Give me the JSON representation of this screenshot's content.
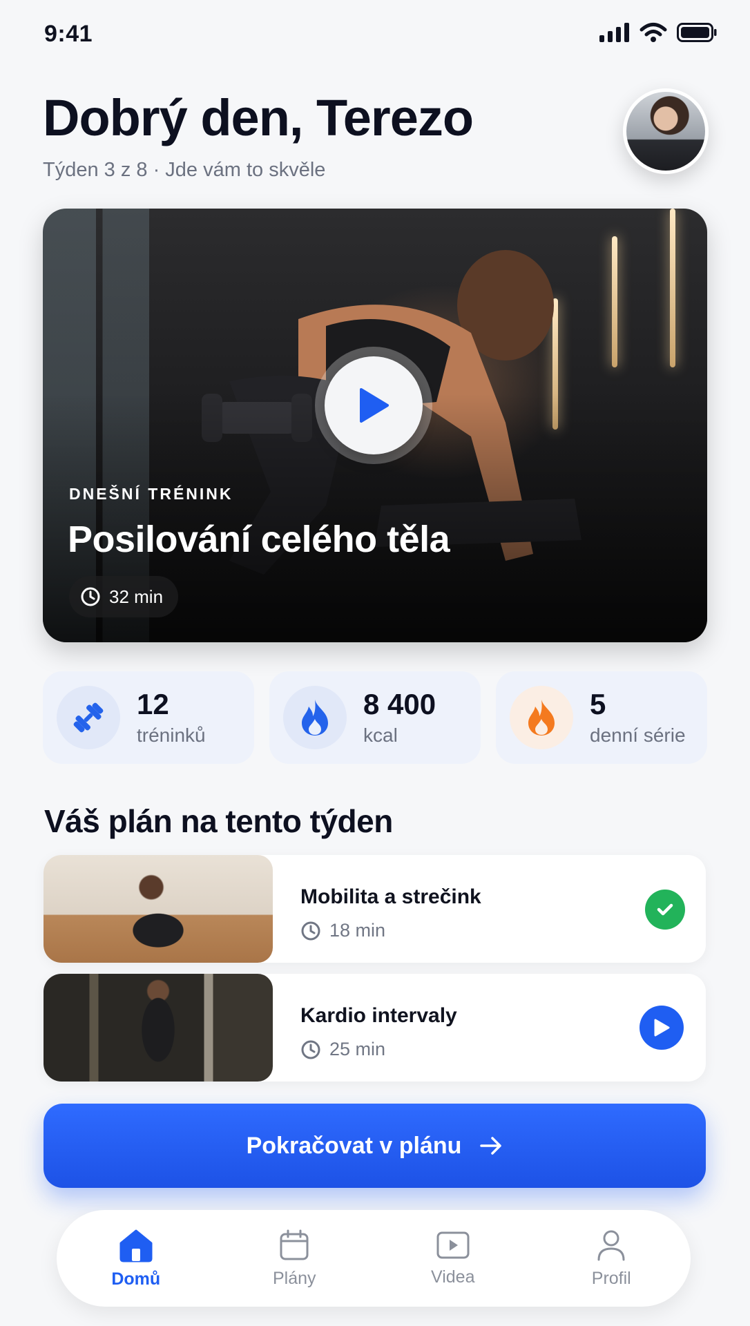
{
  "status_bar": {
    "time": "9:41"
  },
  "header": {
    "greeting": "Dobrý den, Terezo",
    "subline": "Týden 3 z 8 · Jde vám to skvěle"
  },
  "hero": {
    "kicker": "DNEŠNÍ TRÉNINK",
    "title": "Posilování celého těla",
    "duration": "32 min"
  },
  "stats": [
    {
      "value": "12",
      "label": "tréninků",
      "icon": "dumbbell-icon"
    },
    {
      "value": "8 400",
      "label": "kcal",
      "icon": "flame-icon"
    },
    {
      "value": "5",
      "label": "denní série",
      "icon": "fire-icon"
    }
  ],
  "plan": {
    "title": "Váš plán na tento týden",
    "items": [
      {
        "name": "Mobilita a strečink",
        "duration": "18 min",
        "status": "done"
      },
      {
        "name": "Kardio intervaly",
        "duration": "25 min",
        "status": "play"
      }
    ]
  },
  "cta": {
    "label": "Pokračovat v plánu"
  },
  "tabs": [
    {
      "label": "Domů",
      "icon": "home-icon",
      "active": true
    },
    {
      "label": "Plány",
      "icon": "calendar-icon",
      "active": false
    },
    {
      "label": "Videa",
      "icon": "video-icon",
      "active": false
    },
    {
      "label": "Profil",
      "icon": "user-icon",
      "active": false
    }
  ],
  "colors": {
    "accent": "#1f5ef2",
    "success": "#22b35a",
    "fire": "#f47a1f"
  }
}
